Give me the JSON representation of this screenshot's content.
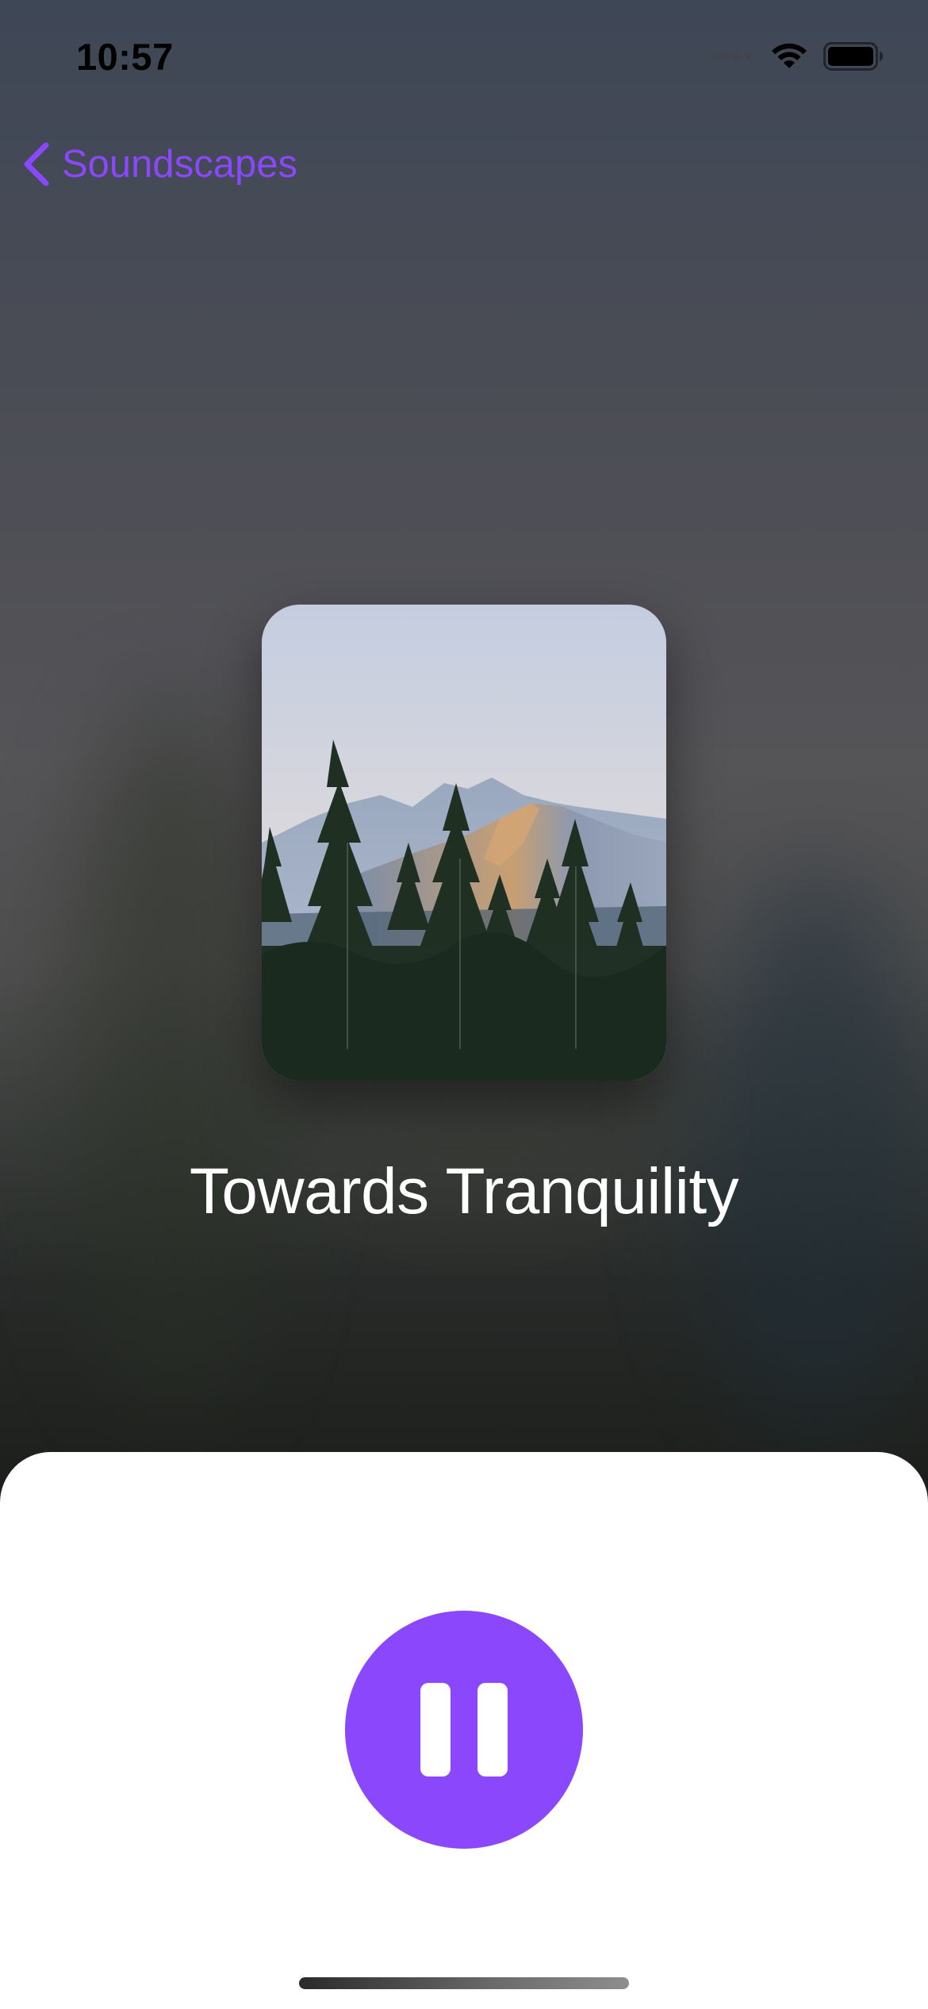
{
  "status_bar": {
    "time": "10:57",
    "icons": [
      "cellular-signal-icon",
      "wifi-icon",
      "battery-icon"
    ]
  },
  "nav": {
    "back_label": "Soundscapes",
    "back_icon": "chevron-left-icon"
  },
  "track": {
    "title": "Towards Tranquility",
    "artwork": "mountain-forest-photo"
  },
  "player": {
    "state": "playing",
    "control_icon": "pause-icon"
  },
  "colors": {
    "accent": "#8a47fb",
    "sheet": "#ffffff",
    "title_text": "#ffffff"
  }
}
